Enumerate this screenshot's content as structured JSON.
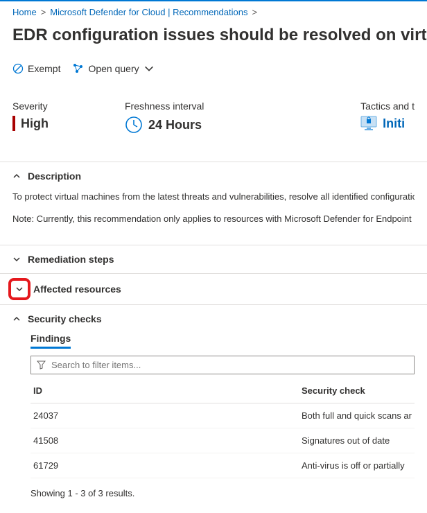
{
  "breadcrumb": {
    "home": "Home",
    "mid": "Microsoft Defender for Cloud | Recommendations"
  },
  "page_title": "EDR configuration issues should be resolved on virtual m",
  "toolbar": {
    "exempt": "Exempt",
    "open_query": "Open query"
  },
  "info": {
    "severity_label": "Severity",
    "severity_value": "High",
    "freshness_label": "Freshness interval",
    "freshness_value": "24 Hours",
    "tactics_label": "Tactics and t",
    "tactics_value": "Initi"
  },
  "sections": {
    "description": "Description",
    "remediation": "Remediation steps",
    "affected": "Affected resources",
    "security": "Security checks"
  },
  "desc_body": {
    "p1": "To protect virtual machines from the latest threats and vulnerabilities, resolve all identified configuration issue",
    "p2": "Note: Currently, this recommendation only applies to resources with Microsoft Defender for Endpoint (MDE) e"
  },
  "findings": {
    "tab": "Findings",
    "search_placeholder": "Search to filter items...",
    "col_id": "ID",
    "col_check": "Security check",
    "rows": [
      {
        "id": "24037",
        "check": "Both full and quick scans ar"
      },
      {
        "id": "41508",
        "check": "Signatures out of date"
      },
      {
        "id": "61729",
        "check": "Anti-virus is off or partially "
      }
    ],
    "results": "Showing 1 - 3 of 3 results."
  }
}
